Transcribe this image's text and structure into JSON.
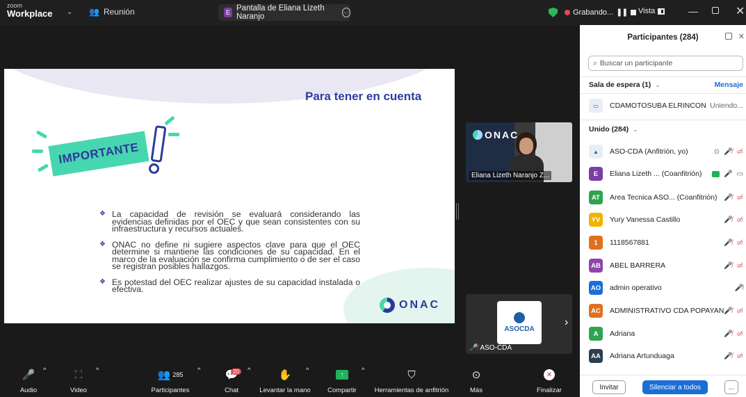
{
  "titlebar": {
    "app_small": "zoom",
    "app_name": "Workplace",
    "meeting_label": "Reunión",
    "share_avatar": "E",
    "share_title": "Pantalla de Eliana Lizeth Naranjo",
    "recording_label": "Grabando...",
    "view_label": "Vista"
  },
  "slide": {
    "title": "Para tener en cuenta",
    "badge": "IMPORTANTE",
    "bullets": [
      "La capacidad de revisión se evaluará considerando las evidencias definidas por el OEC y que sean consistentes con su infraestructura y recursos actuales.",
      "ONAC no define ni sugiere aspectos clave para que el OEC determine si mantiene las condiciones de su capacidad. En el marco de la evaluación se confirma cumplimiento o de ser el caso se registran posibles hallazgos.",
      "Es potestad del OEC realizar ajustes de su capacidad instalada o efectiva."
    ],
    "logo_text": "ONAC"
  },
  "videos": {
    "tile1_brand": "ONAC",
    "tile1_name": "Eliana Lizeth Naranjo Z...",
    "tile2_logo": "ASOCDA",
    "tile2_name": "ASO-CDA"
  },
  "toolbar": {
    "audio": "Audio",
    "video": "Video",
    "participants": "Participantes",
    "participants_count": "285",
    "chat": "Chat",
    "chat_badge": "20",
    "raise_hand": "Levantar la mano",
    "share": "Compartir",
    "host_tools": "Herramientas de anfitrión",
    "more": "Más",
    "end": "Finalizar"
  },
  "panel": {
    "title": "Participantes (284)",
    "search_placeholder": "Buscar un participante",
    "waiting_room": "Sala de espera (1)",
    "message": "Mensaje",
    "waiting": [
      {
        "name": "CDAMOTOSUBA ELRINCON",
        "status": "Uniendo..."
      }
    ],
    "joined": "Unido (284)",
    "participants": [
      {
        "initials": "",
        "color": "#e8eef7",
        "name": "ASO-CDA (Anfitrión, yo)"
      },
      {
        "initials": "E",
        "color": "#7a3ea6",
        "name": "Eliana Lizeth ...  (Coanfitrión)"
      },
      {
        "initials": "AT",
        "color": "#2ea44f",
        "name": "Area Tecnica ASO...  (Coanfitrión)"
      },
      {
        "initials": "YV",
        "color": "#f0b400",
        "name": "Yury Vanessa Castillo"
      },
      {
        "initials": "1",
        "color": "#e0701e",
        "name": "1118567881"
      },
      {
        "initials": "AB",
        "color": "#8e44ad",
        "name": "ABEL BARRERA"
      },
      {
        "initials": "AO",
        "color": "#1a6ed8",
        "name": "admin operativo"
      },
      {
        "initials": "AC",
        "color": "#e0701e",
        "name": "ADMINISTRATIVO CDA POPAYAN"
      },
      {
        "initials": "A",
        "color": "#2ea44f",
        "name": "Adriana"
      },
      {
        "initials": "AA",
        "color": "#2c3e50",
        "name": "Adriana Artunduaga"
      }
    ],
    "invite": "Invitar",
    "mute_all": "Silenciar a todos",
    "more": "..."
  }
}
